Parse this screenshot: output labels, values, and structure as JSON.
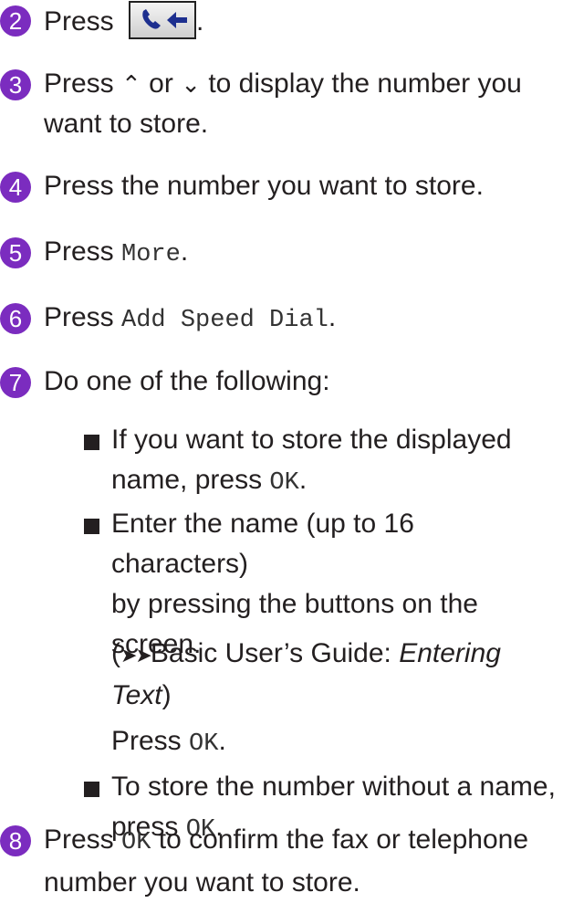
{
  "colors": {
    "step_circle": "#7b2cbf",
    "text": "#231f20"
  },
  "steps": [
    {
      "num": "2",
      "pre": "Press ",
      "post": "."
    },
    {
      "num": "3",
      "pre": "Press ",
      "up": "⌃",
      "mid": " or ",
      "down": "⌄",
      "post": " to display the number you",
      "line2": "want to store."
    },
    {
      "num": "4",
      "text": "Press the number you want to store."
    },
    {
      "num": "5",
      "pre": "Press ",
      "key": "More",
      "post": "."
    },
    {
      "num": "6",
      "pre": "Press ",
      "key": "Add Speed Dial",
      "post": "."
    },
    {
      "num": "7",
      "text": "Do one of the following:"
    },
    {
      "num": "8",
      "pre": "Press ",
      "key": "OK",
      "post": " to confirm the fax or telephone",
      "line2": "number you want to store."
    }
  ],
  "options": [
    {
      "line1": "If you want to store the displayed",
      "line2pre": "name, press ",
      "line2key": "OK",
      "line2post": "."
    },
    {
      "line1": "Enter the name (up to 16 characters)",
      "line2": "by pressing the buttons on the",
      "line3": "screen.",
      "ref_pre": "(",
      "ref_arrows": "➤➤",
      "ref_text": "Basic User’s Guide: ",
      "ref_italic1": "Entering",
      "ref_italic2": "Text",
      "ref_post": ")",
      "press_pre": "Press ",
      "press_key": "OK",
      "press_post": "."
    },
    {
      "line1": "To store the number without a name,",
      "line2pre": "press ",
      "line2key": "OK",
      "line2post": "."
    }
  ],
  "icons": {
    "call_back_button": "phone-back-icon"
  }
}
